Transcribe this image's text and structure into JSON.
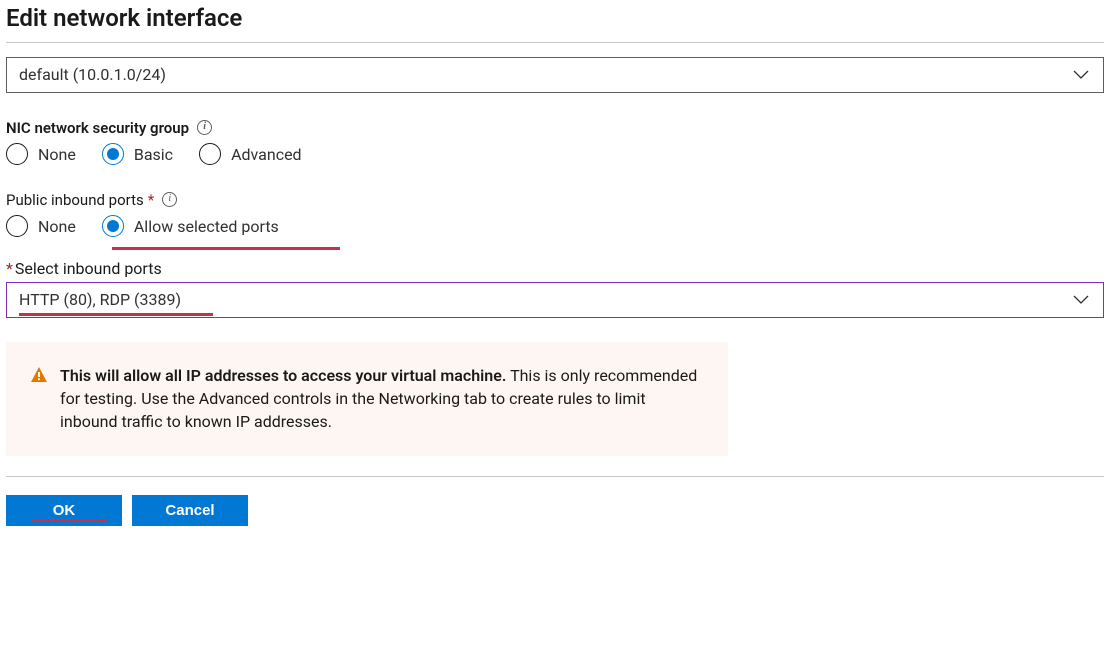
{
  "title": "Edit network interface",
  "subnet": {
    "value": "default (10.0.1.0/24)"
  },
  "nsg": {
    "label": "NIC network security group",
    "options": {
      "none": "None",
      "basic": "Basic",
      "advanced": "Advanced"
    },
    "selected": "basic"
  },
  "inboundPorts": {
    "label": "Public inbound ports",
    "options": {
      "none": "None",
      "allow": "Allow selected ports"
    },
    "selected": "allow"
  },
  "selectPorts": {
    "label": "Select inbound ports",
    "value": "HTTP (80), RDP (3389)"
  },
  "warning": {
    "bold": "This will allow all IP addresses to access your virtual machine.",
    "rest": "  This is only recommended for testing.  Use the Advanced controls in the Networking tab to create rules to limit inbound traffic to known IP addresses."
  },
  "buttons": {
    "ok": "OK",
    "cancel": "Cancel"
  }
}
